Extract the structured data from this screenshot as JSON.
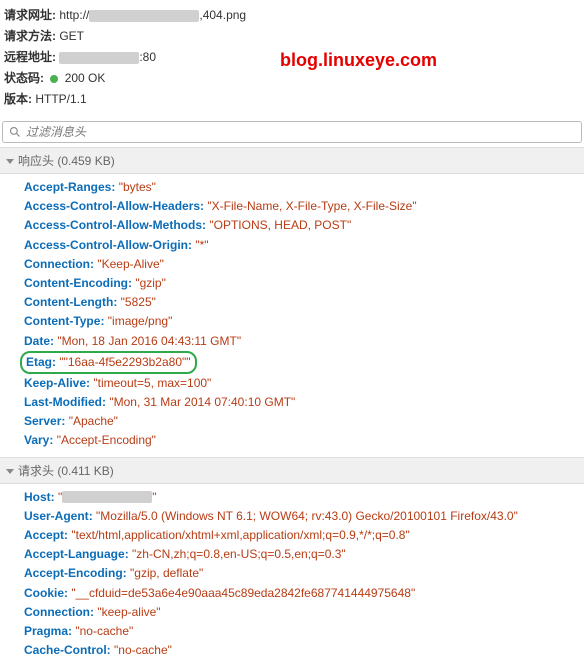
{
  "general": {
    "url_label": "请求网址:",
    "url_prefix": "http://",
    "url_suffix": ",404.png",
    "method_label": "请求方法:",
    "method_value": "GET",
    "remote_label": "远程地址:",
    "remote_suffix": ":80",
    "status_label": "状态码:",
    "status_value": "200 OK",
    "version_label": "版本:",
    "version_value": "HTTP/1.1"
  },
  "watermark": "blog.linuxeye.com",
  "filter_placeholder": "过滤消息头",
  "response_section": "响应头 (0.459 KB)",
  "request_section": "请求头 (0.411 KB)",
  "response_headers": [
    {
      "k": "Accept-Ranges",
      "v": "\"bytes\""
    },
    {
      "k": "Access-Control-Allow-Headers",
      "v": "\"X-File-Name, X-File-Type, X-File-Size\""
    },
    {
      "k": "Access-Control-Allow-Methods",
      "v": "\"OPTIONS, HEAD, POST\""
    },
    {
      "k": "Access-Control-Allow-Origin",
      "v": "\"*\""
    },
    {
      "k": "Connection",
      "v": "\"Keep-Alive\""
    },
    {
      "k": "Content-Encoding",
      "v": "\"gzip\""
    },
    {
      "k": "Content-Length",
      "v": "\"5825\""
    },
    {
      "k": "Content-Type",
      "v": "\"image/png\""
    },
    {
      "k": "Date",
      "v": "\"Mon, 18 Jan 2016 04:43:11 GMT\""
    },
    {
      "k": "Etag",
      "v": "\"\"16aa-4f5e2293b2a80\"\"",
      "highlight": true
    },
    {
      "k": "Keep-Alive",
      "v": "\"timeout=5, max=100\""
    },
    {
      "k": "Last-Modified",
      "v": "\"Mon, 31 Mar 2014 07:40:10 GMT\""
    },
    {
      "k": "Server",
      "v": "\"Apache\""
    },
    {
      "k": "Vary",
      "v": "\"Accept-Encoding\""
    }
  ],
  "request_headers": [
    {
      "k": "Host",
      "v": "\"",
      "redacted": true
    },
    {
      "k": "User-Agent",
      "v": "\"Mozilla/5.0 (Windows NT 6.1; WOW64; rv:43.0) Gecko/20100101 Firefox/43.0\""
    },
    {
      "k": "Accept",
      "v": "\"text/html,application/xhtml+xml,application/xml;q=0.9,*/*;q=0.8\""
    },
    {
      "k": "Accept-Language",
      "v": "\"zh-CN,zh;q=0.8,en-US;q=0.5,en;q=0.3\""
    },
    {
      "k": "Accept-Encoding",
      "v": "\"gzip, deflate\""
    },
    {
      "k": "Cookie",
      "v": "\"__cfduid=de53a6e4e90aaa45c89eda2842fe687741444975648\""
    },
    {
      "k": "Connection",
      "v": "\"keep-alive\""
    },
    {
      "k": "Pragma",
      "v": "\"no-cache\""
    },
    {
      "k": "Cache-Control",
      "v": "\"no-cache\""
    }
  ]
}
